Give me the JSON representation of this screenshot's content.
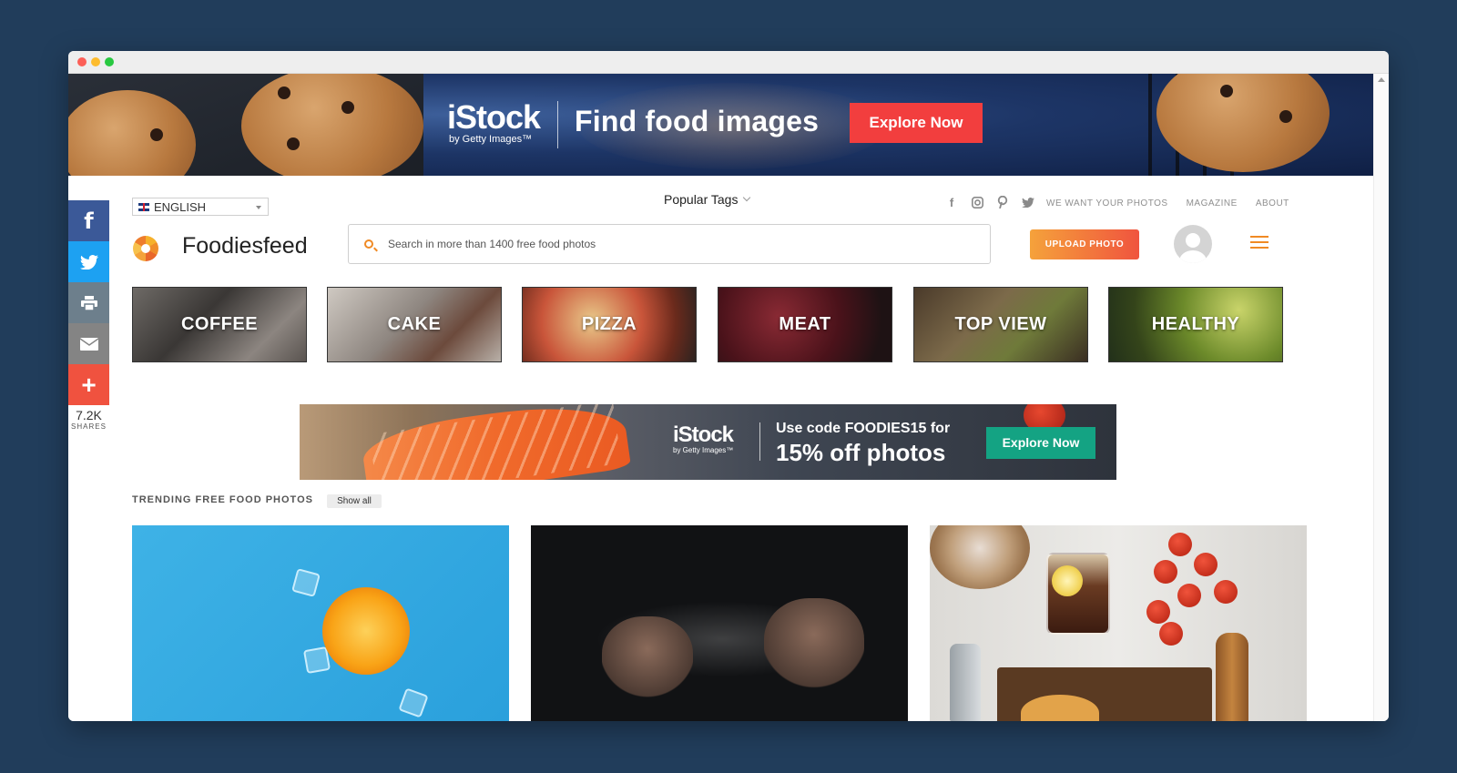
{
  "top_banner": {
    "brand": "iStock",
    "brand_sub": "by Getty Images™",
    "headline": "Find food images",
    "cta": "Explore Now"
  },
  "share_bar": {
    "icons": [
      "facebook-icon",
      "twitter-icon",
      "print-icon",
      "email-icon",
      "plus-icon"
    ],
    "count": "7.2K",
    "label": "SHARES"
  },
  "header": {
    "language": "ENGLISH",
    "popular_tags": "Popular Tags",
    "social_icons": [
      "facebook-icon",
      "instagram-icon",
      "pinterest-icon",
      "twitter-icon"
    ],
    "links": [
      "WE WANT YOUR PHOTOS",
      "MAGAZINE",
      "ABOUT"
    ],
    "brand": "Foodiesfeed",
    "search_placeholder": "Search in more than 1400 free food photos",
    "upload_label": "UPLOAD PHOTO"
  },
  "categories": [
    "COFFEE",
    "CAKE",
    "PIZZA",
    "MEAT",
    "TOP VIEW",
    "HEALTHY"
  ],
  "mid_banner": {
    "brand": "iStock",
    "brand_sub": "by Getty Images™",
    "line1": "Use code FOODIES15 for",
    "line2": "15% off photos",
    "cta": "Explore Now"
  },
  "trending": {
    "title": "TRENDING FREE FOOD PHOTOS",
    "show_all": "Show all"
  },
  "colors": {
    "accent": "#f08a24",
    "banner_cta": "#f23e3e",
    "mid_cta": "#14a383",
    "facebook": "#3b5998",
    "twitter": "#1da1f2",
    "more": "#f0523f",
    "backdrop": "#213d5b"
  }
}
